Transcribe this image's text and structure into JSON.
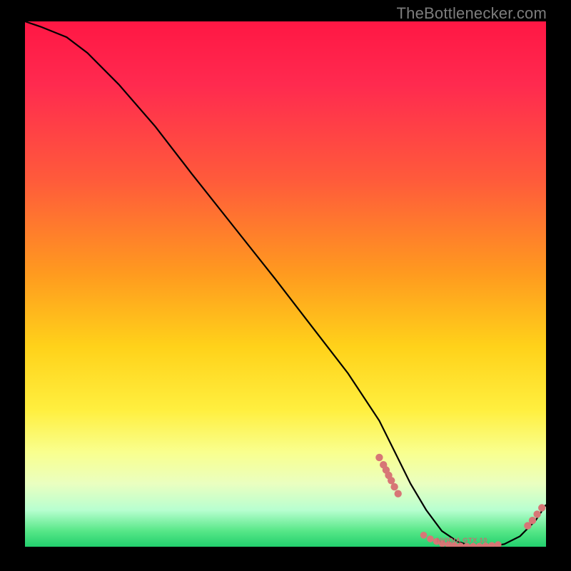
{
  "attribution": "TheBottlenecker.com",
  "chart_data": {
    "type": "line",
    "title": "",
    "xlabel": "",
    "ylabel": "",
    "xlim": [
      0,
      100
    ],
    "ylim": [
      0,
      100
    ],
    "x": [
      0,
      3,
      8,
      12,
      18,
      25,
      32,
      40,
      48,
      55,
      62,
      68,
      71,
      74,
      77,
      80,
      83,
      86,
      89,
      92,
      95,
      98,
      100
    ],
    "y": [
      100,
      99,
      97,
      94,
      88,
      80,
      71,
      61,
      51,
      42,
      33,
      24,
      18,
      12,
      7,
      3,
      1,
      0,
      0,
      0.5,
      2,
      5,
      8
    ],
    "clusters": [
      {
        "name": "left-slope-cluster",
        "points": [
          {
            "x": 68,
            "y": 17
          },
          {
            "x": 68.8,
            "y": 15.6
          },
          {
            "x": 69.3,
            "y": 14.6
          },
          {
            "x": 69.8,
            "y": 13.6
          },
          {
            "x": 70.3,
            "y": 12.6
          },
          {
            "x": 70.9,
            "y": 11.4
          },
          {
            "x": 71.6,
            "y": 10.1
          }
        ]
      },
      {
        "name": "bottom-ribbon-cluster",
        "points": [
          {
            "x": 76.5,
            "y": 2.2
          },
          {
            "x": 77.8,
            "y": 1.5
          },
          {
            "x": 79.0,
            "y": 1.0
          },
          {
            "x": 80.1,
            "y": 0.6
          },
          {
            "x": 81.3,
            "y": 0.4
          },
          {
            "x": 82.4,
            "y": 0.25
          },
          {
            "x": 83.6,
            "y": 0.15
          },
          {
            "x": 84.8,
            "y": 0.1
          },
          {
            "x": 86.0,
            "y": 0.1
          },
          {
            "x": 87.2,
            "y": 0.1
          },
          {
            "x": 88.4,
            "y": 0.15
          },
          {
            "x": 89.6,
            "y": 0.25
          },
          {
            "x": 90.8,
            "y": 0.4
          }
        ]
      },
      {
        "name": "right-slope-cluster",
        "points": [
          {
            "x": 96.5,
            "y": 4.0
          },
          {
            "x": 97.4,
            "y": 5.0
          },
          {
            "x": 98.3,
            "y": 6.2
          },
          {
            "x": 99.2,
            "y": 7.4
          }
        ]
      }
    ],
    "ribbon_label": "NVIDIA GTX 10"
  },
  "colors": {
    "dot": "#d77676",
    "curve": "#000000",
    "attribution": "#7d7d7d"
  }
}
